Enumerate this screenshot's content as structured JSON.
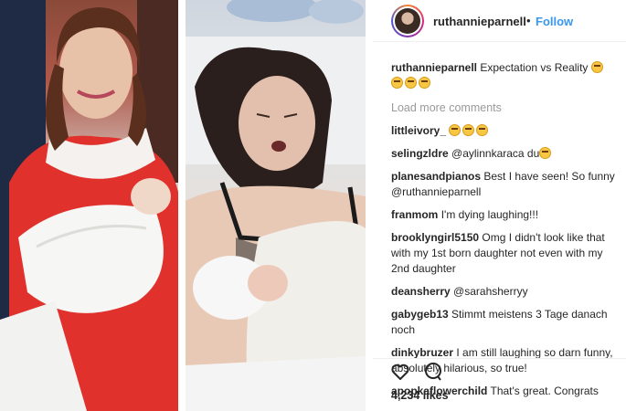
{
  "post": {
    "username": "ruthannieparnell",
    "separator": "•",
    "follow_label": "Follow",
    "caption": {
      "username": "ruthannieparnell",
      "text": "Expectation vs Reality"
    },
    "load_more_label": "Load more comments",
    "comments": [
      {
        "username": "littleivory_",
        "text": ""
      },
      {
        "username": "selingzldre",
        "text": "@aylinnkaraca du"
      },
      {
        "username": "planesandpianos",
        "text": "Best I have seen! So funny @ruthannieparnell"
      },
      {
        "username": "franmom",
        "text": "I'm dying laughing!!!"
      },
      {
        "username": "brooklyngirl5150",
        "text": "Omg I didn't look like that with my 1st born daughter not even with my 2nd daughter"
      },
      {
        "username": "deansherry",
        "text": "@sarahsherryy"
      },
      {
        "username": "gabygeb13",
        "text": "Stimmt meistens 3 Tage danach noch"
      },
      {
        "username": "dinkybruzer",
        "text": "I am still laughing so darn funny, absolutely hilarious, so true!"
      },
      {
        "username": "apopkaflowerchild",
        "text": "That's great. Congrats"
      }
    ],
    "likes": "4,234 likes"
  },
  "icons": {
    "heart": "heart-icon",
    "comment": "comment-bubble-icon",
    "emoji": "grimacing-emoji"
  },
  "colors": {
    "link_blue": "#3897f0",
    "muted": "#999999",
    "text": "#262626"
  }
}
